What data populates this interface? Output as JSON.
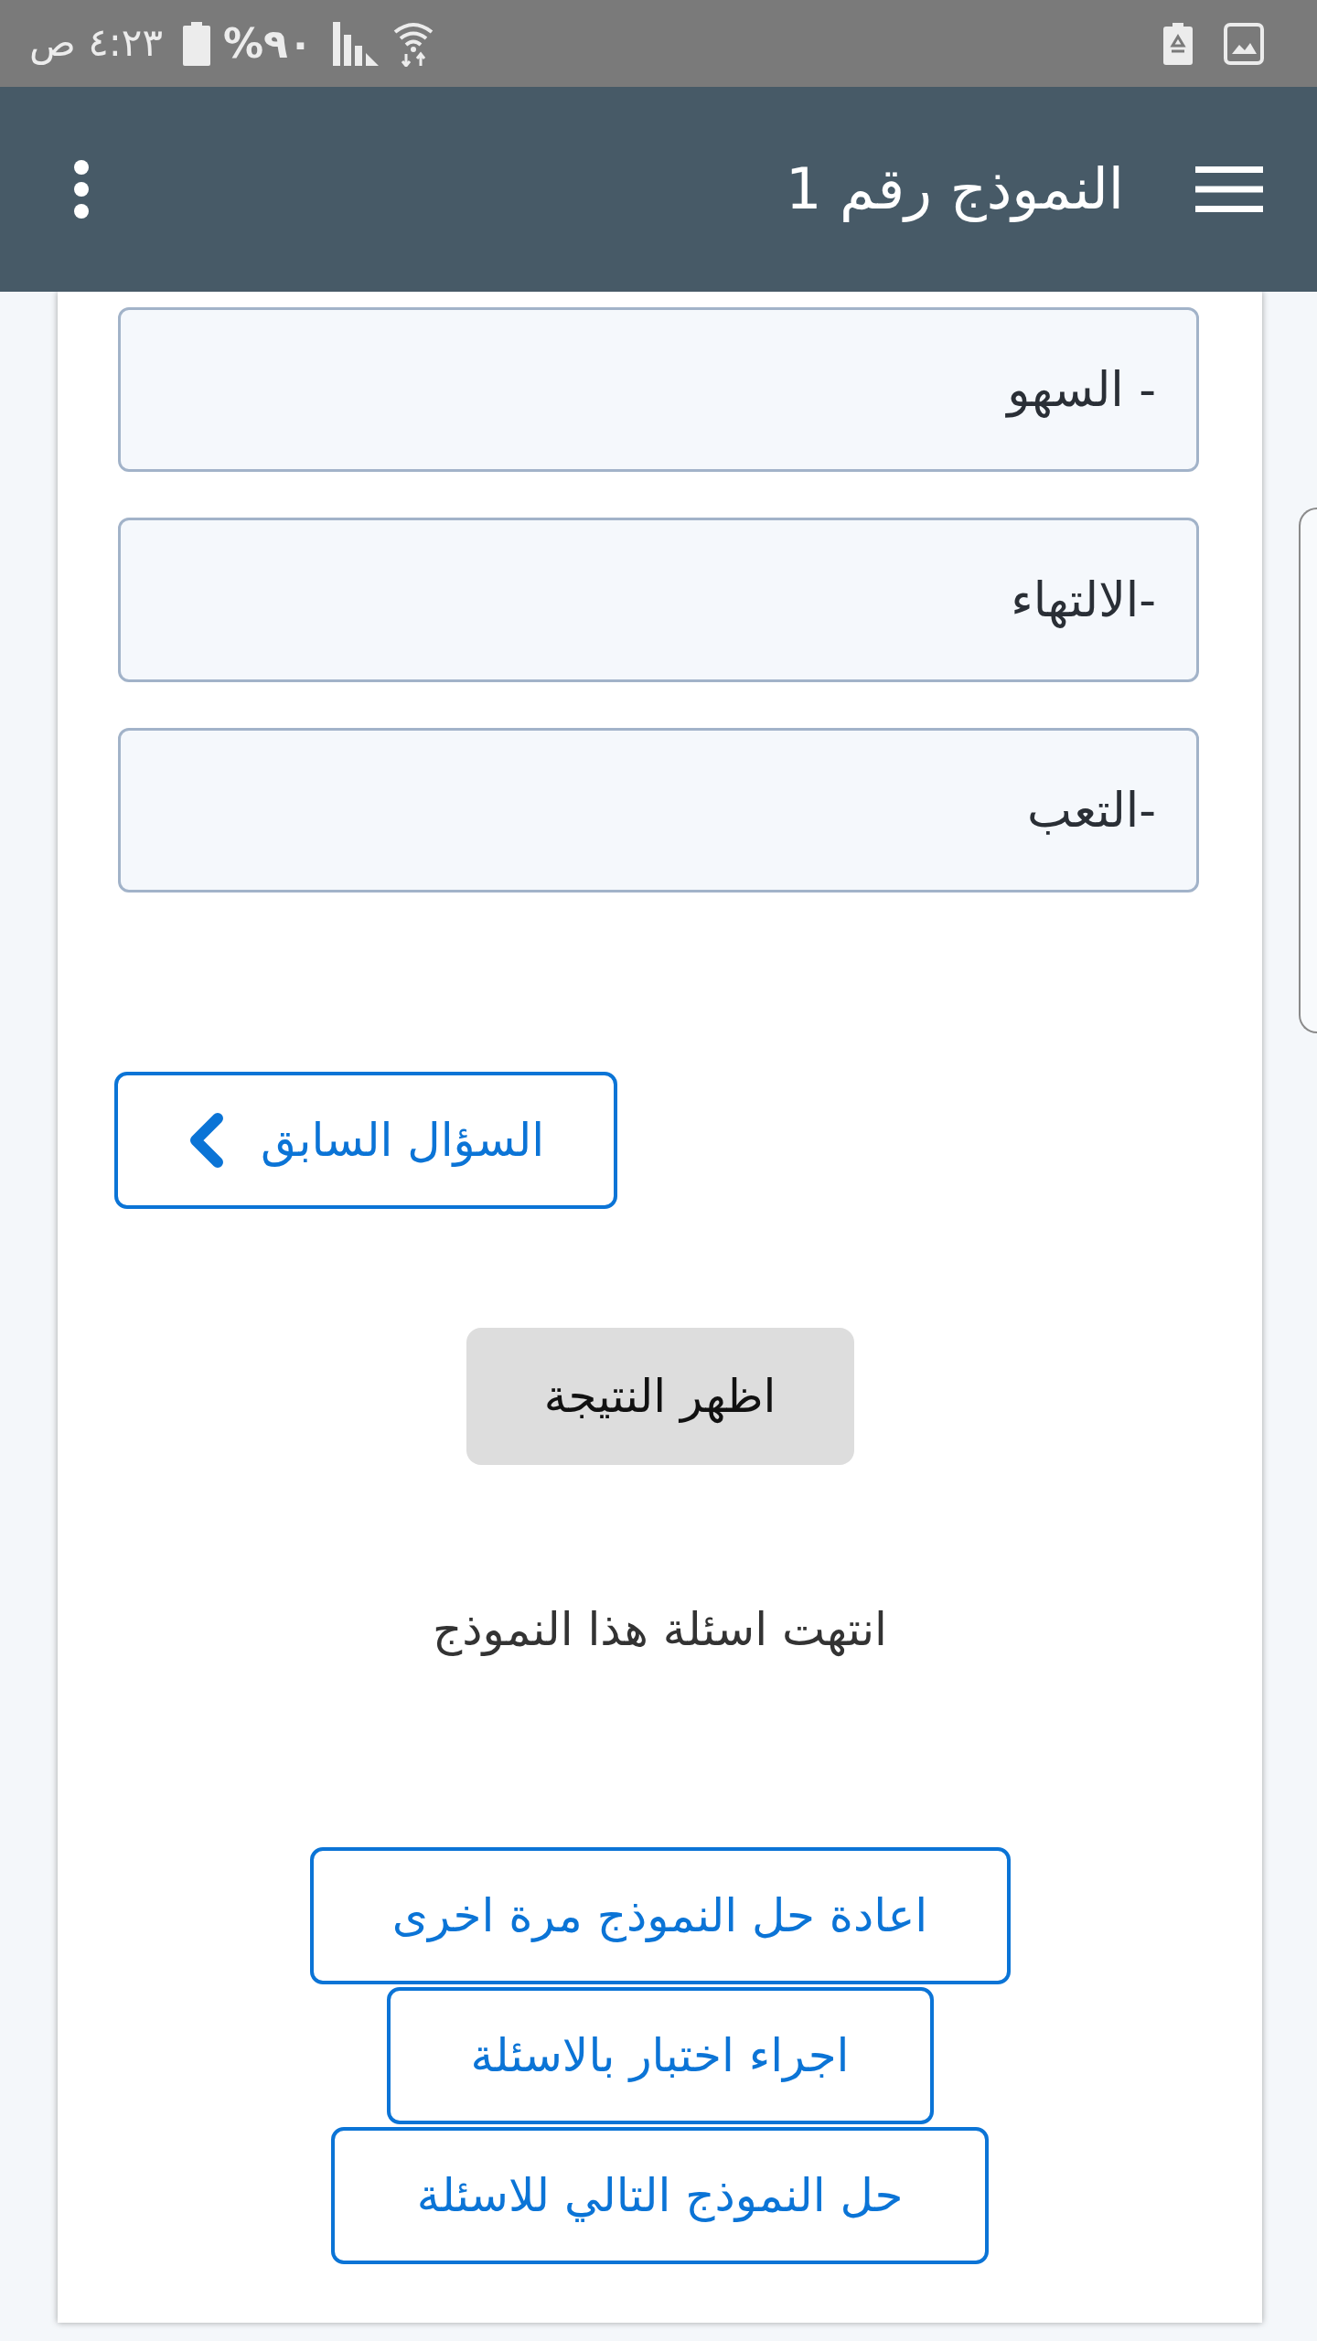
{
  "status_bar": {
    "time": "٤:٢٣ ص",
    "battery": "%٩٠"
  },
  "app_bar": {
    "title": "النموذج رقم 1"
  },
  "options": [
    {
      "label": "- السهو",
      "selected": false
    },
    {
      "label": "-الالتهاء",
      "selected": false
    },
    {
      "label": "-التعب",
      "selected": false
    }
  ],
  "previous_button": {
    "label": "السؤال السابق"
  },
  "show_result_button": {
    "label": "اظهر النتيجة"
  },
  "end_message": "انتهت اسئلة هذا النموذج",
  "actions": [
    {
      "label": "اعادة حل النموذج مرة اخرى"
    },
    {
      "label": "اجراء اختبار بالاسئلة"
    },
    {
      "label": "حل النموذج التالي للاسئلة"
    }
  ]
}
